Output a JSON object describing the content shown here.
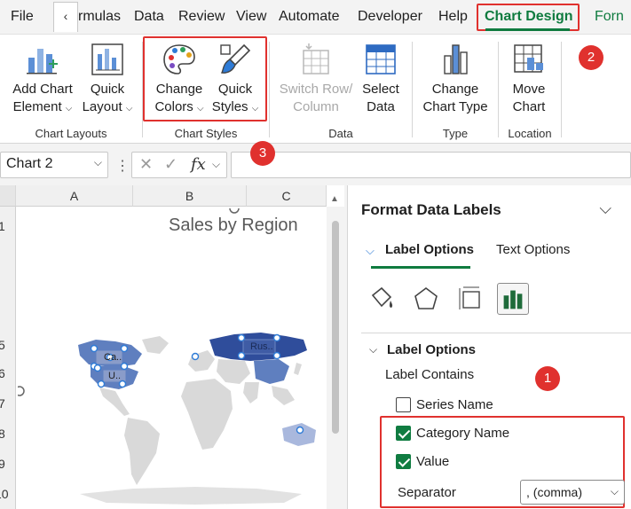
{
  "tabs": {
    "file": "File",
    "scroll_left": "‹",
    "formulas": "rmulas",
    "data": "Data",
    "review": "Review",
    "view": "View",
    "automate": "Automate",
    "developer": "Developer",
    "help": "Help",
    "chart_design": "Chart Design",
    "format": "Forn"
  },
  "ribbon": {
    "add_chart_element": [
      "Add Chart",
      "Element"
    ],
    "quick_layout": [
      "Quick",
      "Layout"
    ],
    "change_colors": [
      "Change",
      "Colors"
    ],
    "quick_styles": [
      "Quick",
      "Styles"
    ],
    "switch_row_column": [
      "Switch Row/",
      "Column"
    ],
    "select_data": [
      "Select",
      "Data"
    ],
    "change_chart_type": [
      "Change",
      "Chart Type"
    ],
    "move_chart": [
      "Move",
      "Chart"
    ],
    "groups": {
      "chart_layouts": "Chart Layouts",
      "chart_styles": "Chart Styles",
      "data": "Data",
      "type": "Type",
      "location": "Location"
    }
  },
  "badges": {
    "one": "1",
    "two": "2",
    "three": "3"
  },
  "formula_bar": {
    "name_box": "Chart 2",
    "fx": "fx",
    "cancel": "✕",
    "enter": "✓"
  },
  "sheet": {
    "columns": [
      "A",
      "B",
      "C"
    ],
    "rows": [
      "1",
      "5",
      "6",
      "7",
      "8",
      "9",
      "10"
    ],
    "chart_title": "Sales by Region",
    "map_labels": [
      "Ca..",
      "U..",
      "Rus.."
    ]
  },
  "pane": {
    "title": "Format Data Labels",
    "tab_label_options": "Label Options",
    "tab_text_options": "Text Options",
    "section_title": "Label Options",
    "label_contains": "Label Contains",
    "series_name": "Series Name",
    "category_name": "Category Name",
    "value": "Value",
    "separator_label": "Separator",
    "separator_value": ", (comma)",
    "checks": {
      "series_name": false,
      "category_name": true,
      "value": true
    }
  },
  "colors": {
    "accent": "#0f7b3f",
    "highlight": "#e0312e",
    "map_dark": "#2f4d9b",
    "map_mid": "#5f7fbf",
    "map_light": "#a9b8dd",
    "map_grey": "#d9d9d9"
  }
}
